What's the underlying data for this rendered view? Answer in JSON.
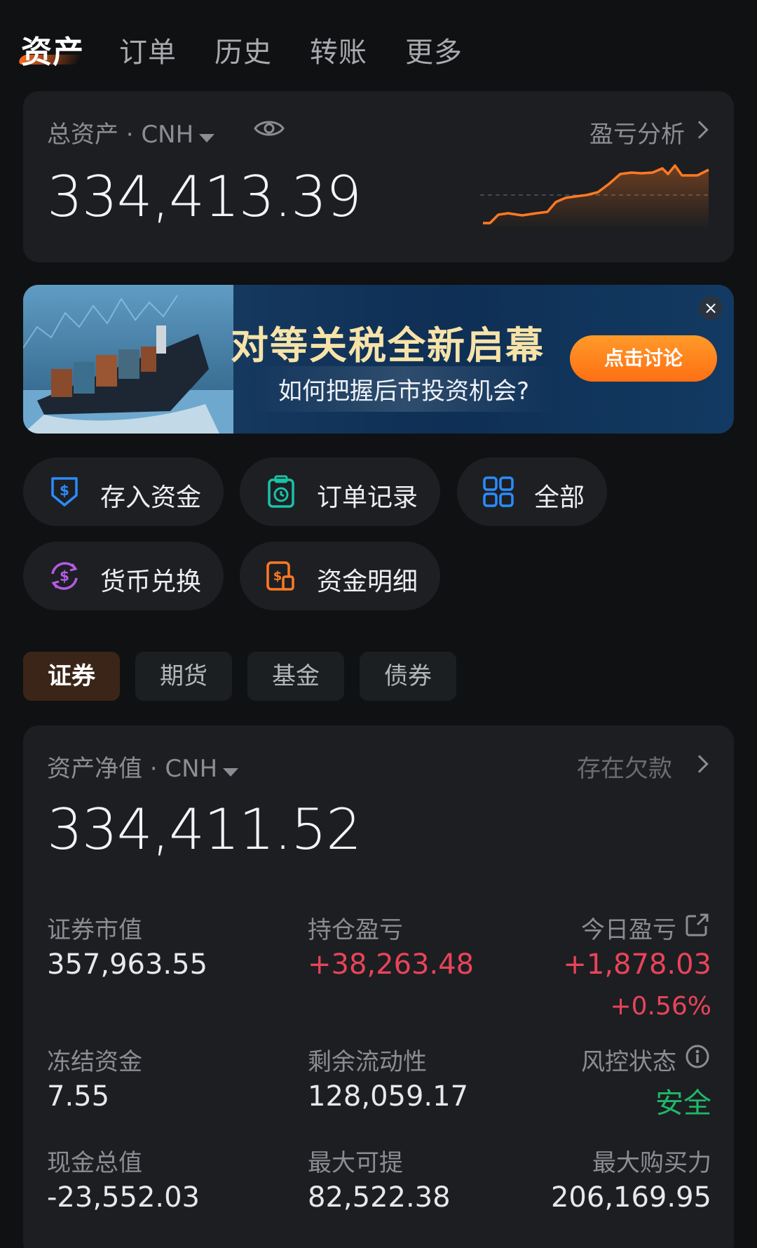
{
  "nav": {
    "tabs": [
      "资产",
      "订单",
      "历史",
      "转账",
      "更多"
    ]
  },
  "total_assets": {
    "label": "总资产 · CNH",
    "value": "334,413.39",
    "analysis_link": "盈亏分析"
  },
  "banner": {
    "title": "对等关税全新启幕",
    "subtitle": "如何把握后市投资机会?",
    "button": "点击讨论",
    "close": "×"
  },
  "quick_actions": [
    {
      "label": "存入资金",
      "icon": "deposit-icon",
      "color": "#2b8cff"
    },
    {
      "label": "订单记录",
      "icon": "order-record-icon",
      "color": "#19c3a8"
    },
    {
      "label": "全部",
      "icon": "grid-icon",
      "color": "#2b8cff"
    },
    {
      "label": "货币兑换",
      "icon": "currency-exchange-icon",
      "color": "#b45ce6"
    },
    {
      "label": "资金明细",
      "icon": "fund-detail-icon",
      "color": "#ff7a22"
    }
  ],
  "asset_tabs": [
    "证券",
    "期货",
    "基金",
    "债券"
  ],
  "net_assets": {
    "label": "资产净值 · CNH",
    "value": "334,411.52",
    "debt_link": "存在欠款",
    "stats": {
      "market_value": {
        "label": "证券市值",
        "value": "357,963.55"
      },
      "position_pl": {
        "label": "持仓盈亏",
        "value": "+38,263.48"
      },
      "today_pl": {
        "label": "今日盈亏",
        "value": "+1,878.03",
        "percent": "+0.56%"
      },
      "frozen_funds": {
        "label": "冻结资金",
        "value": "7.55"
      },
      "remaining_liquidity": {
        "label": "剩余流动性",
        "value": "128,059.17"
      },
      "risk_status": {
        "label": "风控状态",
        "value": "安全"
      },
      "cash_total": {
        "label": "现金总值",
        "value": "-23,552.03"
      },
      "max_withdraw": {
        "label": "最大可提",
        "value": "82,522.38"
      },
      "max_buying_power": {
        "label": "最大购买力",
        "value": "206,169.95"
      }
    }
  },
  "colors": {
    "accent": "#ff6a1a",
    "gain": "#e8445a",
    "safe": "#1fb86a",
    "card": "#1d1e21",
    "background": "#101113"
  }
}
